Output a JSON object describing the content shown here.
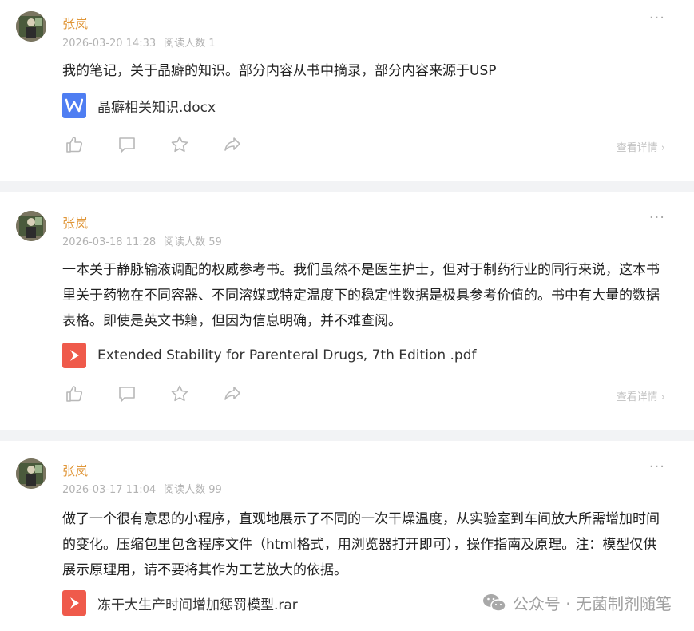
{
  "posts": [
    {
      "author": "张岚",
      "date": "2026-03-20 14:33",
      "readers": "阅读人数 1",
      "text": "我的笔记，关于晶癖的知识。部分内容从书中摘录，部分内容来源于USP",
      "file": {
        "name": "晶癖相关知识.docx",
        "type": "word-doc-icon",
        "color": "#4f7ef2"
      },
      "more": "···",
      "detail": "查看详情 ›"
    },
    {
      "author": "张岚",
      "date": "2026-03-18 11:28",
      "readers": "阅读人数 59",
      "text": "一本关于静脉输液调配的权威参考书。我们虽然不是医生护士，但对于制药行业的同行来说，这本书里关于药物在不同容器、不同溶媒或特定温度下的稳定性数据是极具参考价值的。书中有大量的数据表格。即使是英文书籍，但因为信息明确，并不难查阅。",
      "file": {
        "name": "Extended Stability for Parenteral Drugs, 7th Edition .pdf",
        "type": "pdf-icon",
        "color": "#ef5a4b"
      },
      "more": "···",
      "detail": "查看详情 ›"
    },
    {
      "author": "张岚",
      "date": "2026-03-17 11:04",
      "readers": "阅读人数 99",
      "text": "做了一个很有意思的小程序，直观地展示了不同的一次干燥温度，从实验室到车间放大所需增加时间的变化。压缩包里包含程序文件（html格式，用浏览器打开即可），操作指南及原理。注：模型仅供展示原理用，请不要将其作为工艺放大的依据。",
      "file": {
        "name": "冻干大生产时间增加惩罚模型.rar",
        "type": "archive-icon",
        "color": "#ef5a4b"
      },
      "more": "···",
      "detail": ""
    }
  ],
  "watermark": {
    "text": "公众号 · 无菌制剂随笔",
    "icon": "wechat-icon"
  },
  "colors": {
    "author": "#e0973a",
    "meta": "#b3b3b3",
    "separator_bg": "#f2f3f5"
  }
}
